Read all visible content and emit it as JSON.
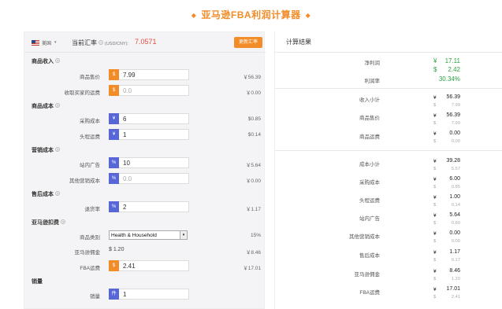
{
  "title": "亚马逊FBA利润计算器",
  "title_deco": "◆",
  "header": {
    "country": "美国",
    "rate_label": "当前汇率",
    "rate_unit": "(USD/CNY):",
    "rate_value": "7.0571",
    "rate_button": "更新汇率"
  },
  "sections": {
    "revenue": "商品收入",
    "cost": "商品成本",
    "marketing": "营销成本",
    "aftersales": "售后成本",
    "amazon_fee": "亚马逊扣费",
    "sales": "销量"
  },
  "fields": {
    "price": {
      "label": "商品售价",
      "tag": "$",
      "value": "7.99",
      "rmb": "￥56.39"
    },
    "shipping_charge": {
      "label": "收取买家的运费",
      "tag": "$",
      "placeholder": "0.0",
      "rmb": "￥0.00"
    },
    "purchase_cost": {
      "label": "采购成本",
      "tag": "¥",
      "value": "6",
      "usd": "$0.85"
    },
    "first_leg": {
      "label": "头程运费",
      "tag": "¥",
      "value": "1",
      "usd": "$0.14"
    },
    "ads": {
      "label": "站内广告",
      "tag": "%",
      "value": "10",
      "rmb": "￥5.64"
    },
    "other_marketing": {
      "label": "其他营销成本",
      "tag": "%",
      "placeholder": "0.0",
      "rmb": "￥0.00"
    },
    "return_rate": {
      "label": "退货率",
      "tag": "%",
      "value": "2",
      "rmb": "￥1.17"
    },
    "category": {
      "label": "商品类别",
      "value": "Health & Household",
      "pct": "15%"
    },
    "commission": {
      "label": "亚马逊佣金",
      "value": "$ 1.20",
      "rmb": "￥8.46"
    },
    "fba_fee": {
      "label": "FBA运费",
      "tag": "$",
      "value": "2.41",
      "rmb": "￥17.01"
    },
    "quantity": {
      "label": "销量",
      "tag": "件",
      "value": "1"
    }
  },
  "results": {
    "title": "计算结果",
    "net_profit": {
      "label": "净利润",
      "cny": "¥",
      "cny_val": "17.11",
      "usd": "$",
      "usd_val": "2.42"
    },
    "margin": {
      "label": "利润率",
      "value": "30.34%"
    },
    "income_subtotal": {
      "label": "收入小计",
      "c1": "¥",
      "v1": "56.39",
      "c2": "$",
      "v2": "7.99"
    },
    "price": {
      "label": "商品售价",
      "c1": "¥",
      "v1": "56.39",
      "c2": "$",
      "v2": "7.99"
    },
    "shipping": {
      "label": "商品运费",
      "c1": "¥",
      "v1": "0.00",
      "c2": "$",
      "v2": "0.00"
    },
    "cost_subtotal": {
      "label": "成本小计",
      "c1": "¥",
      "v1": "39.28",
      "c2": "$",
      "v2": "5.57"
    },
    "purchase": {
      "label": "采购成本",
      "c1": "¥",
      "v1": "6.00",
      "c2": "$",
      "v2": "0.85"
    },
    "first_leg": {
      "label": "头程运费",
      "c1": "¥",
      "v1": "1.00",
      "c2": "$",
      "v2": "0.14"
    },
    "ads": {
      "label": "站内广告",
      "c1": "¥",
      "v1": "5.64",
      "c2": "$",
      "v2": "0.80"
    },
    "other_marketing": {
      "label": "其他营销成本",
      "c1": "¥",
      "v1": "0.00",
      "c2": "$",
      "v2": "0.00"
    },
    "aftersales": {
      "label": "售后成本",
      "c1": "¥",
      "v1": "1.17",
      "c2": "$",
      "v2": "0.17"
    },
    "commission": {
      "label": "亚马逊佣金",
      "c1": "¥",
      "v1": "8.46",
      "c2": "$",
      "v2": "1.20"
    },
    "fba": {
      "label": "FBA运费",
      "c1": "¥",
      "v1": "17.01",
      "c2": "$",
      "v2": "2.41"
    }
  },
  "colors": {
    "accent": "#f28c28",
    "blue_tag": "#5867d8",
    "profit": "#2ea043",
    "rate": "#e74c3c"
  }
}
